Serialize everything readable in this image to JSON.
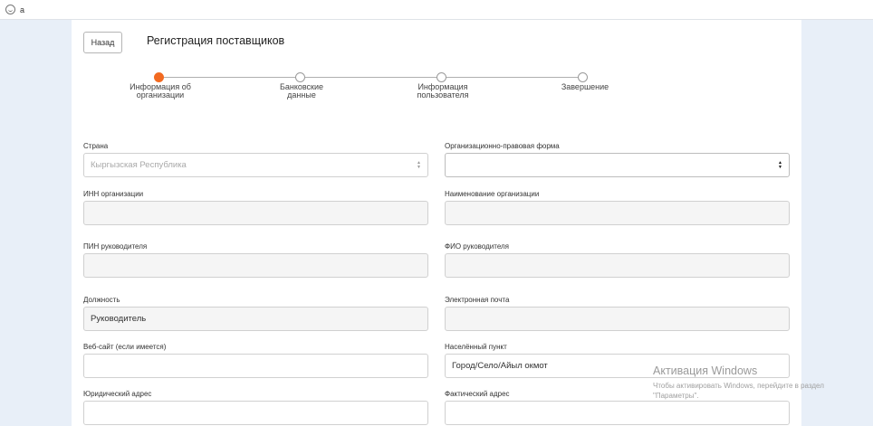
{
  "browser": {
    "brand": "a"
  },
  "header": {
    "back_label": "Назад",
    "title": "Регистрация поставщиков"
  },
  "steps": [
    {
      "label": "Информация об организации",
      "state": "active"
    },
    {
      "label": "Банковские данные",
      "state": "pending"
    },
    {
      "label": "Информация пользователя",
      "state": "pending"
    },
    {
      "label": "Завершение",
      "state": "pending"
    }
  ],
  "form": {
    "country": {
      "label": "Страна",
      "value": "Кыргызская Республика"
    },
    "legal_form": {
      "label": "Организационно-правовая форма",
      "value": ""
    },
    "inn": {
      "label": "ИНН организации",
      "value": ""
    },
    "org_name": {
      "label": "Наименование организации",
      "value": ""
    },
    "pin": {
      "label": "ПИН руководителя",
      "value": ""
    },
    "director_name": {
      "label": "ФИО руководителя",
      "value": ""
    },
    "position": {
      "label": "Должность",
      "value": "Руководитель"
    },
    "email": {
      "label": "Электронная почта",
      "value": ""
    },
    "website": {
      "label": "Веб-сайт (если имеется)",
      "value": ""
    },
    "locality": {
      "label": "Населённый пункт",
      "value": "Город/Село/Айыл окмот"
    },
    "legal_address": {
      "label": "Юридический адрес",
      "value": ""
    },
    "actual_address": {
      "label": "Фактический адрес",
      "value": ""
    }
  },
  "watermark": {
    "title": "Активация Windows",
    "line1": "Чтобы активировать Windows, перейдите в раздел",
    "line2": "\"Параметры\"."
  },
  "colors": {
    "accent": "#f26a21",
    "page_bg": "#e8eff8"
  }
}
